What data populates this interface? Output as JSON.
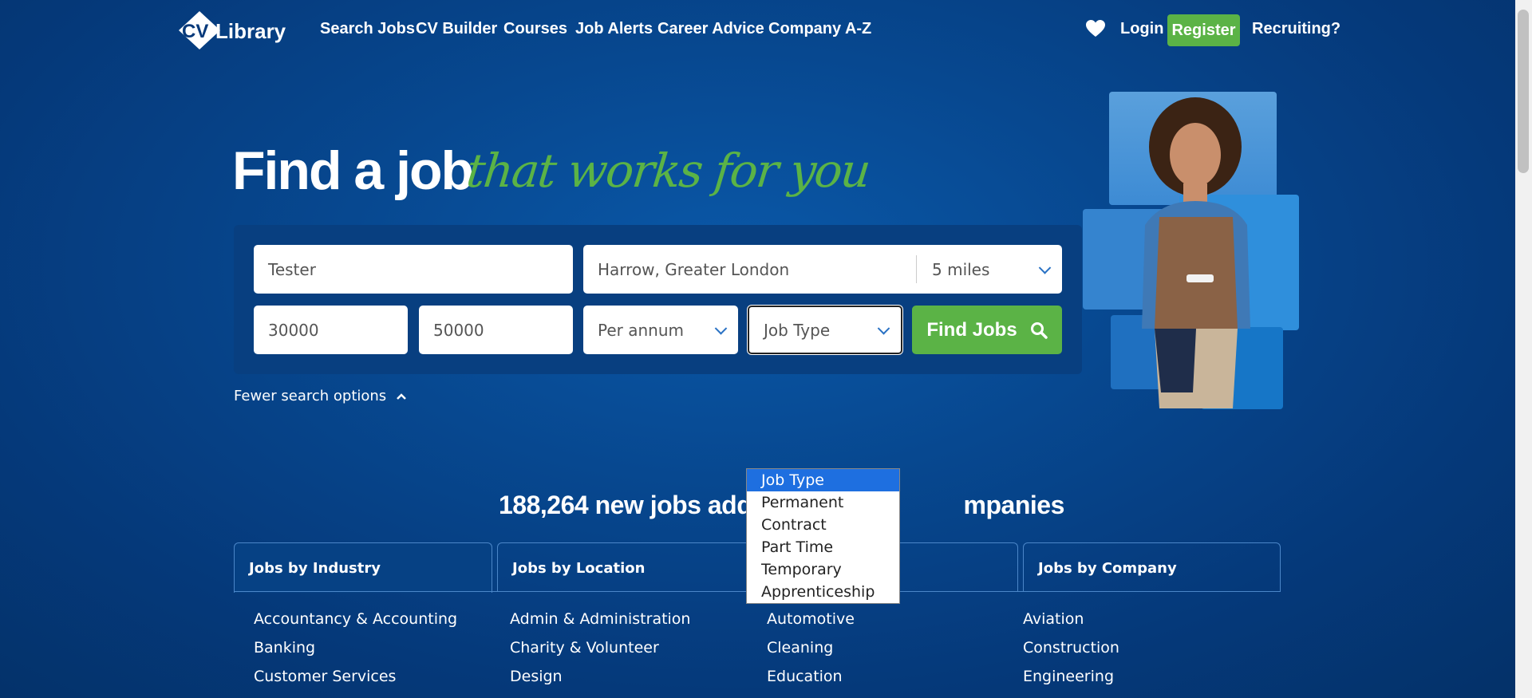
{
  "brand": {
    "logo_text": "CV Library"
  },
  "nav": {
    "items": [
      "Search Jobs",
      "CV Builder",
      "Courses",
      "Job Alerts",
      "Career Advice",
      "Company A-Z"
    ],
    "login": "Login",
    "register": "Register",
    "recruiting": "Recruiting?"
  },
  "hero": {
    "title": "Find a job",
    "subtitle": "that works for you"
  },
  "search": {
    "keywords": "Tester",
    "location": "Harrow, Greater London",
    "distance": "5 miles",
    "salary_min": "30000",
    "salary_max": "50000",
    "salary_period": "Per annum",
    "job_type": "Job Type",
    "find_button": "Find Jobs",
    "fewer_options": "Fewer search options"
  },
  "job_type_dropdown": {
    "options": [
      "Job Type",
      "Permanent",
      "Contract",
      "Part Time",
      "Temporary",
      "Apprenticeship"
    ],
    "selected": "Job Type"
  },
  "stats": {
    "headline_left": "188,264 new jobs adde",
    "headline_right": "mpanies"
  },
  "tabs": [
    "Jobs by Industry",
    "Jobs by Location",
    "",
    "Jobs by Company"
  ],
  "columns": [
    [
      "Accountancy & Accounting",
      "Banking",
      "Customer Services"
    ],
    [
      "Admin & Administration",
      "Charity & Volunteer",
      "Design"
    ],
    [
      "Automotive",
      "Cleaning",
      "Education"
    ],
    [
      "Aviation",
      "Construction",
      "Engineering"
    ]
  ],
  "colors": {
    "brand_green": "#5bb346",
    "navy": "#05397a",
    "select_blue": "#1e6fe0"
  }
}
